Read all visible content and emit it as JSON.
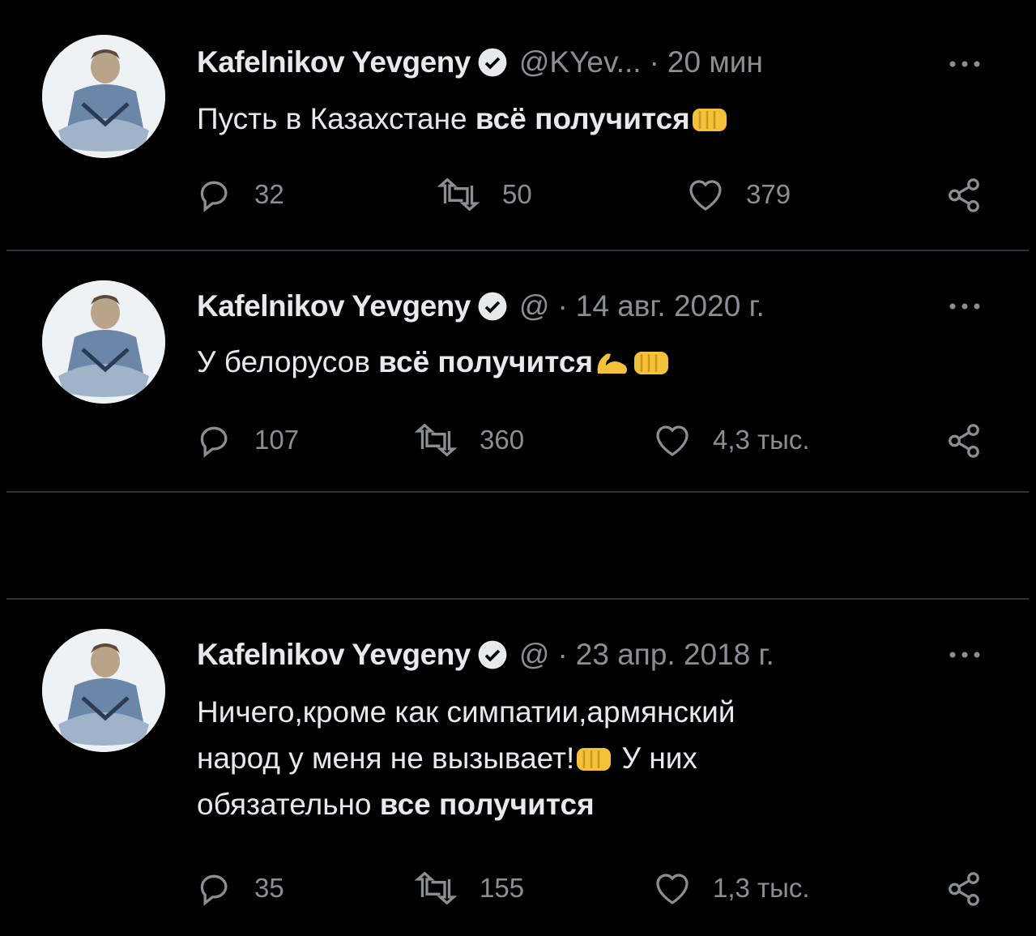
{
  "tweets": [
    {
      "author": "Kafelnikov Yevgeny",
      "handle": "@KYev...",
      "time": "20 мин",
      "text_normal": "Пусть в Казахстане ",
      "text_bold": "всё получится",
      "emojis": [
        "fist-emoji"
      ],
      "replies": "32",
      "retweets": "50",
      "likes": "379"
    },
    {
      "author": "Kafelnikov Yevgeny",
      "handle": "@",
      "time": "14 авг. 2020 г.",
      "text_normal": "У белорусов ",
      "text_bold": "всё получится",
      "emojis": [
        "flexed-biceps-emoji",
        "fist-emoji"
      ],
      "replies": "107",
      "retweets": "360",
      "likes": "4,3 тыс."
    },
    {
      "author": "Kafelnikov Yevgeny",
      "handle": "@",
      "time": "23 апр. 2018 г.",
      "text_line1": "Ничего,кроме как симпатии,армянский",
      "text_line2_a": "народ у меня не вызывает!",
      "text_line2_b": " У них",
      "text_line3_a": "обязательно ",
      "text_line3_bold": "все получится",
      "emojis": [
        "fist-emoji"
      ],
      "replies": "35",
      "retweets": "155",
      "likes": "1,3 тыс."
    }
  ],
  "colors": {
    "background": "#000000",
    "text": "#e7e9ea",
    "muted": "#8b8f94",
    "divider": "#2f3336",
    "emoji": "#f3c239"
  },
  "icons": [
    "reply-icon",
    "retweet-icon",
    "like-icon",
    "share-icon",
    "more-icon",
    "verified-badge-icon"
  ]
}
